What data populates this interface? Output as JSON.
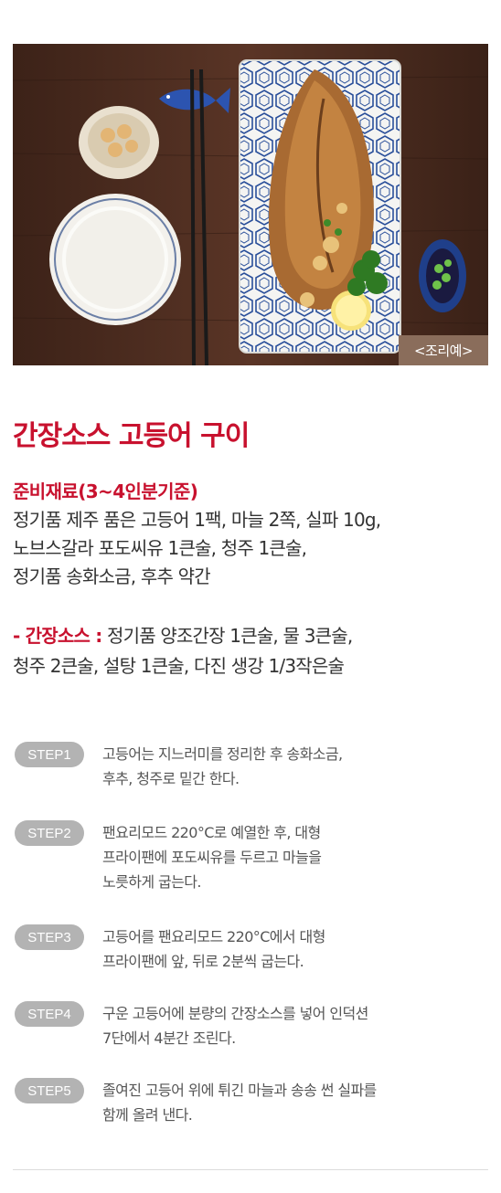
{
  "photo": {
    "caption": "<조리예>"
  },
  "recipe": {
    "title": "간장소스 고등어 구이",
    "ingredients_heading": "준비재료(3~4인분기준)",
    "ingredients_lines": [
      "정기품 제주 품은 고등어 1팩, 마늘 2쪽, 실파 10g,",
      "노브스갈라 포도씨유 1큰술, 청주 1큰술,",
      "정기품 송화소금, 후추 약간"
    ],
    "sauce_label": "- 간장소스 :",
    "sauce_lines": [
      " 정기품 양조간장 1큰술, 물 3큰술,",
      "청주 2큰술, 설탕 1큰술, 다진 생강 1/3작은술"
    ]
  },
  "steps": [
    {
      "label": "STEP1",
      "lines": [
        "고등어는 지느러미를 정리한 후 송화소금,",
        "후추, 청주로 밑간 한다."
      ]
    },
    {
      "label": "STEP2",
      "lines": [
        "팬요리모드 220°C로 예열한 후, 대형",
        "프라이팬에 포도씨유를 두르고 마늘을",
        "노릇하게 굽는다."
      ]
    },
    {
      "label": "STEP3",
      "lines": [
        "고등어를 팬요리모드 220°C에서 대형",
        "프라이팬에 앞, 뒤로 2분씩 굽는다."
      ]
    },
    {
      "label": "STEP4",
      "lines": [
        "구운 고등어에 분량의 간장소스를 넣어 인덕션",
        "7단에서 4분간 조린다."
      ]
    },
    {
      "label": "STEP5",
      "lines": [
        "졸여진 고등어 위에 튀긴 마늘과 송송 썬 실파를",
        "함께 올려 낸다."
      ]
    }
  ],
  "colors": {
    "accent": "#c8112e",
    "step_pill": "#b3b3b3",
    "body_text": "#333333",
    "caption_bg": "#8a6d5b",
    "table_wood": "#4a2c1f"
  }
}
